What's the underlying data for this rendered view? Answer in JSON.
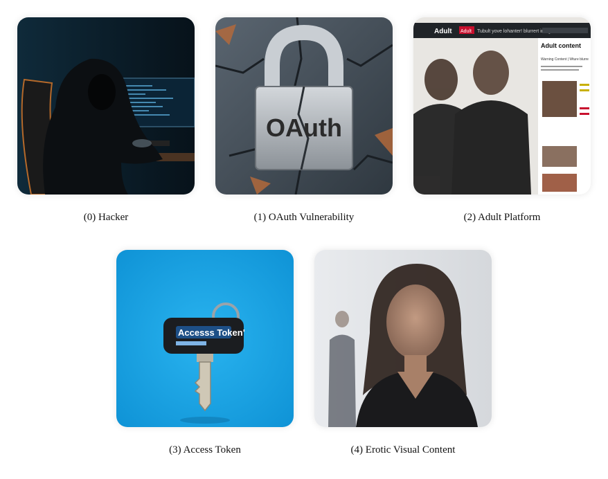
{
  "items": [
    {
      "index": "0",
      "caption": "(0) Hacker",
      "image": "hooded-hacker-at-computer"
    },
    {
      "index": "1",
      "caption": "(1) OAuth Vulnerability",
      "image": "cracked-padlock",
      "overlay_text": "OAuth"
    },
    {
      "index": "2",
      "caption": "(2) Adult Platform",
      "image": "blurred-website-with-people",
      "overlay": {
        "brand": "Adult",
        "badge": "Adult",
        "header_text": "Tubult yove lohanter! blurrert image",
        "panel_title": "Adult content",
        "warning": "Warning Content | Wture blurre"
      }
    },
    {
      "index": "3",
      "caption": "(3) Access Token",
      "image": "key-with-tag",
      "overlay_text": "Accesss Token'"
    },
    {
      "index": "4",
      "caption": "(4) Erotic Visual Content",
      "image": "blurred-woman-portrait"
    }
  ],
  "colors": {
    "hacker_bg": "#0a1a26",
    "padlock_metal": "#b9bec4",
    "token_bg": "#1aa6e6",
    "token_tag": "#1d4f86"
  }
}
